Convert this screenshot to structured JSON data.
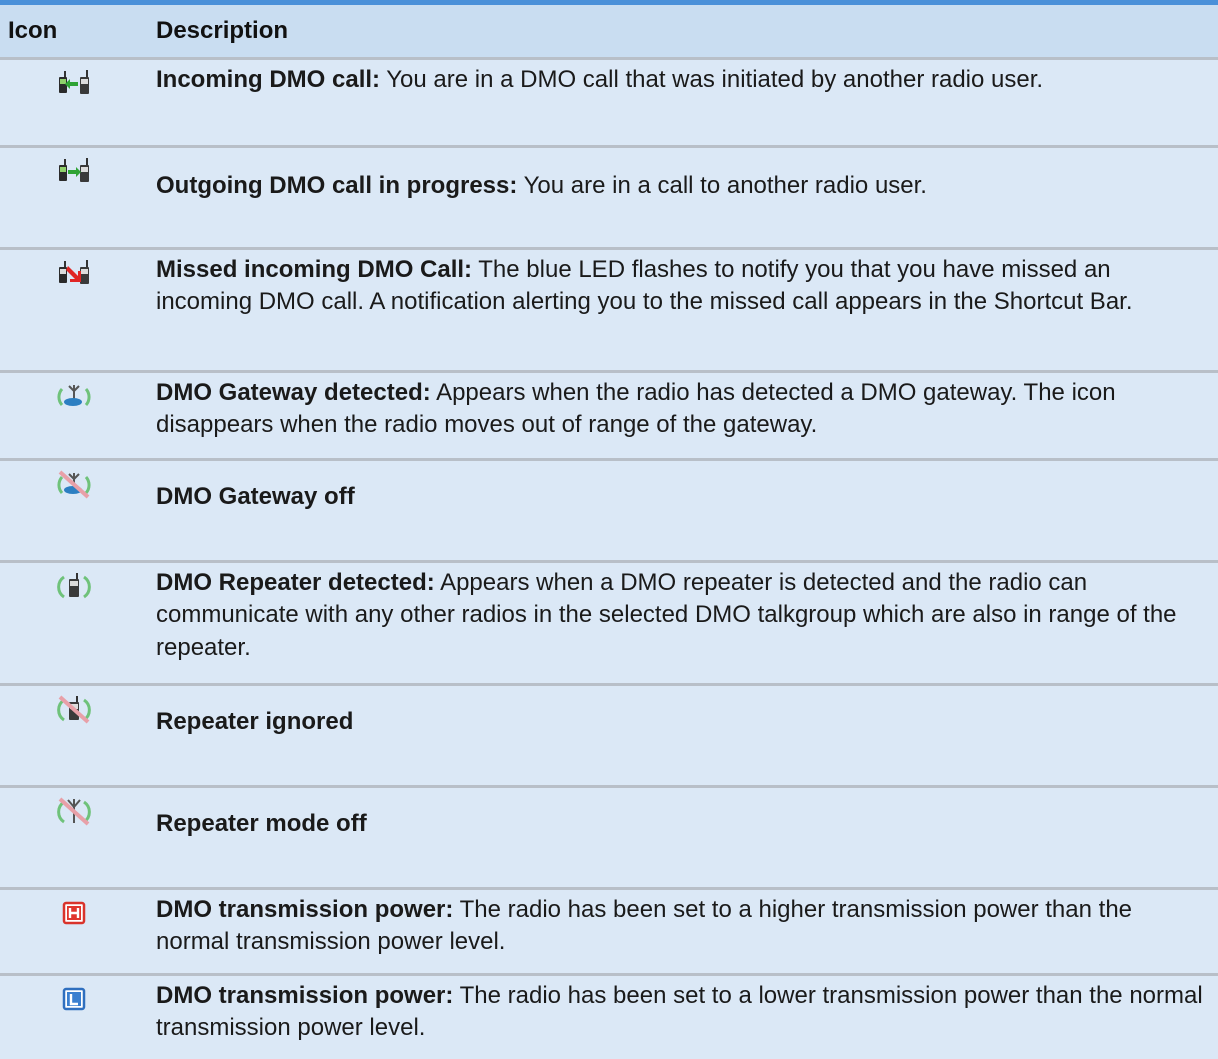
{
  "table": {
    "headers": {
      "icon": "Icon",
      "description": "Description"
    },
    "rows": [
      {
        "icon": "incoming-dmo-call-icon",
        "title": "Incoming DMO call:",
        "text": " You are in a DMO call that was initiated by another radio user."
      },
      {
        "icon": "outgoing-dmo-call-icon",
        "title": "Outgoing DMO call in progress:",
        "text": " You are in a call to another radio user."
      },
      {
        "icon": "missed-dmo-call-icon",
        "title": "Missed incoming DMO Call:",
        "text": " The blue LED flashes to notify you that you have missed an incoming DMO call. A notification alerting you to the missed call appears in the Shortcut Bar."
      },
      {
        "icon": "dmo-gateway-detected-icon",
        "title": "DMO Gateway detected:",
        "text": " Appears when the radio has detected a DMO gateway. The icon disappears when the radio moves out of range of the gateway."
      },
      {
        "icon": "dmo-gateway-off-icon",
        "title": "DMO Gateway off",
        "text": ""
      },
      {
        "icon": "dmo-repeater-detected-icon",
        "title": "DMO Repeater detected:",
        "text": " Appears when a DMO repeater is detected and the radio can communicate with any other radios in the selected DMO talkgroup which are also in range of the repeater."
      },
      {
        "icon": "repeater-ignored-icon",
        "title": "Repeater ignored",
        "text": ""
      },
      {
        "icon": "repeater-mode-off-icon",
        "title": "Repeater mode off",
        "text": ""
      },
      {
        "icon": "high-power-icon",
        "title": "DMO transmission power:",
        "text": " The radio has been set to a higher transmission power than the normal transmission power level."
      },
      {
        "icon": "low-power-icon",
        "title": "DMO transmission power:",
        "text": " The radio has been set to a lower transmission power than the normal transmission power level."
      }
    ]
  }
}
